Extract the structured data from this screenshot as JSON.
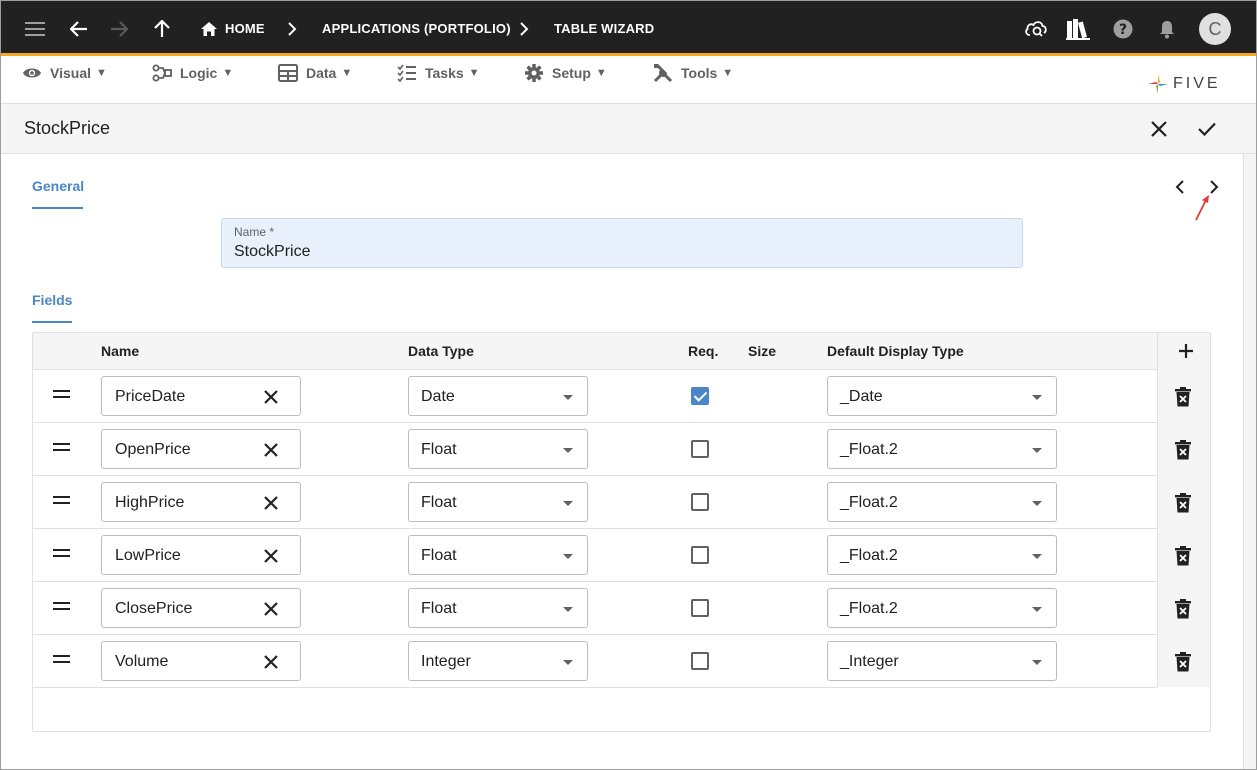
{
  "topbar": {
    "breadcrumbs": [
      "HOME",
      "APPLICATIONS (PORTFOLIO)",
      "TABLE WIZARD"
    ],
    "avatar_initial": "C",
    "icons": [
      "menu-icon",
      "back-icon",
      "forward-icon",
      "up-icon",
      "home-icon",
      "chevron-right-icon",
      "cloud-search-icon",
      "library-icon",
      "help-icon",
      "bell-icon"
    ]
  },
  "menubar": {
    "items": [
      {
        "label": "Visual",
        "icon": "eye-icon"
      },
      {
        "label": "Logic",
        "icon": "logic-icon"
      },
      {
        "label": "Data",
        "icon": "table-icon"
      },
      {
        "label": "Tasks",
        "icon": "tasks-icon"
      },
      {
        "label": "Setup",
        "icon": "gear-icon"
      },
      {
        "label": "Tools",
        "icon": "tools-icon"
      }
    ],
    "logo_text": "FIVE"
  },
  "form": {
    "title": "StockPrice",
    "general_tab": "General",
    "fields_tab": "Fields",
    "name_label": "Name *",
    "name_value": "StockPrice"
  },
  "table": {
    "headers": {
      "name": "Name",
      "data_type": "Data Type",
      "req": "Req.",
      "size": "Size",
      "display_type": "Default Display Type"
    },
    "rows": [
      {
        "name": "PriceDate",
        "data_type": "Date",
        "required": true,
        "display_type": "_Date"
      },
      {
        "name": "OpenPrice",
        "data_type": "Float",
        "required": false,
        "display_type": "_Float.2"
      },
      {
        "name": "HighPrice",
        "data_type": "Float",
        "required": false,
        "display_type": "_Float.2"
      },
      {
        "name": "LowPrice",
        "data_type": "Float",
        "required": false,
        "display_type": "_Float.2"
      },
      {
        "name": "ClosePrice",
        "data_type": "Float",
        "required": false,
        "display_type": "_Float.2"
      },
      {
        "name": "Volume",
        "data_type": "Integer",
        "required": false,
        "display_type": "_Integer"
      }
    ]
  },
  "colors": {
    "accent": "#4a86c8",
    "topbar": "#212121",
    "topbar_border": "#f5a623",
    "annotation": "#e53935"
  }
}
